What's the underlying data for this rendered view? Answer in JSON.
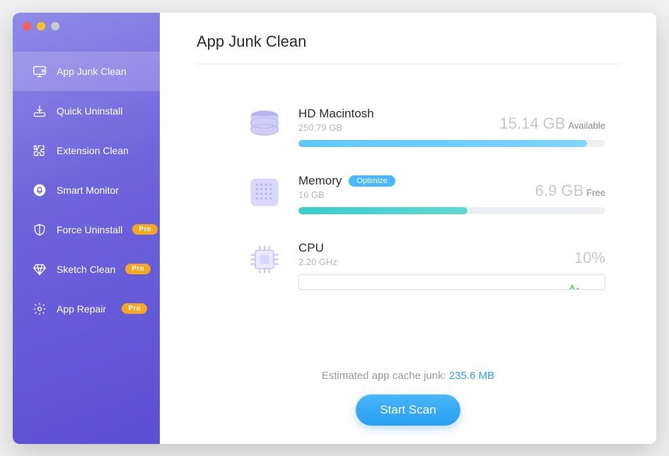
{
  "page": {
    "title": "App Junk Clean"
  },
  "sidebar": {
    "items": [
      {
        "label": "App Junk Clean",
        "icon": "monitor-clean-icon",
        "active": true,
        "pro": false
      },
      {
        "label": "Quick Uninstall",
        "icon": "download-box-icon",
        "active": false,
        "pro": false
      },
      {
        "label": "Extension Clean",
        "icon": "puzzle-icon",
        "active": false,
        "pro": false
      },
      {
        "label": "Smart Monitor",
        "icon": "bell-circle-icon",
        "active": false,
        "pro": false
      },
      {
        "label": "Force Uninstall",
        "icon": "shield-icon",
        "active": false,
        "pro": true
      },
      {
        "label": "Sketch Clean",
        "icon": "diamond-icon",
        "active": false,
        "pro": true
      },
      {
        "label": "App Repair",
        "icon": "gear-icon",
        "active": false,
        "pro": true
      }
    ],
    "pro_label": "Pro"
  },
  "stats": {
    "disk": {
      "name": "HD Macintosh",
      "total": "250.79 GB",
      "value": "15.14 GB",
      "unit": "Available",
      "fill_pct": 94
    },
    "memory": {
      "name": "Memory",
      "total": "16 GB",
      "value": "6.9 GB",
      "unit": "Free",
      "optimize_label": "Optimize",
      "fill_pct": 55
    },
    "cpu": {
      "name": "CPU",
      "total": "2.20 GHz",
      "value": "10%",
      "unit": ""
    }
  },
  "footer": {
    "estimate_label": "Estimated app cache junk: ",
    "estimate_value": "235.6 MB",
    "scan_label": "Start Scan"
  },
  "colors": {
    "accent": "#2e9ef0",
    "sidebar_gradient_start": "#8e8be8",
    "sidebar_gradient_end": "#5b4fd2",
    "pro_badge": "#f5a623"
  }
}
